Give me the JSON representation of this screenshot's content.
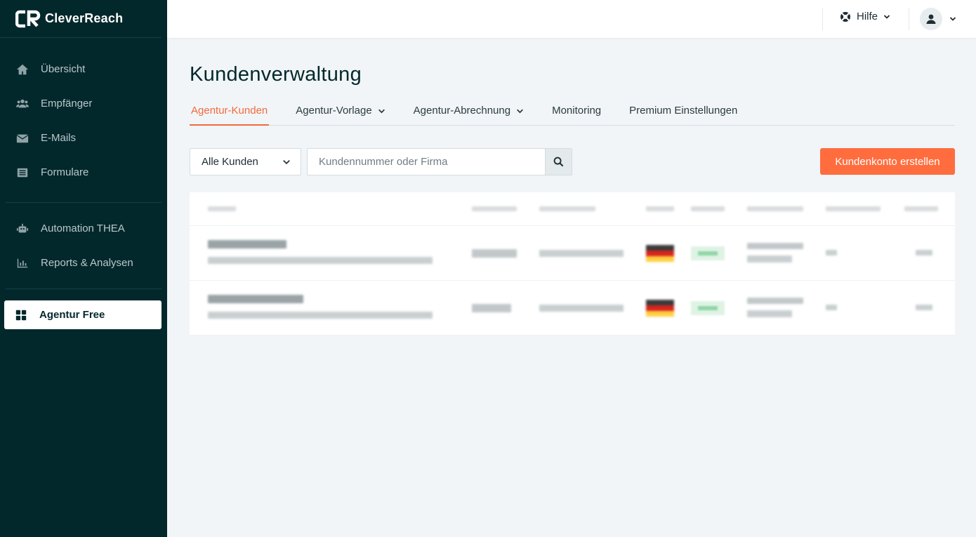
{
  "brand": {
    "name": "CleverReach"
  },
  "sidebar": {
    "items": [
      {
        "label": "Übersicht",
        "icon": "home-icon"
      },
      {
        "label": "Empfänger",
        "icon": "users-icon"
      },
      {
        "label": "E-Mails",
        "icon": "envelope-icon"
      },
      {
        "label": "Formulare",
        "icon": "list-icon"
      },
      {
        "label": "Automation THEA",
        "icon": "robot-icon"
      },
      {
        "label": "Reports & Analysen",
        "icon": "bar-chart-icon"
      },
      {
        "label": "Agentur Free",
        "icon": "grid-icon",
        "active": true
      }
    ]
  },
  "topbar": {
    "help_label": "Hilfe",
    "help_icon": "lifebuoy-icon",
    "user_icon": "user-icon"
  },
  "page": {
    "title": "Kundenverwaltung",
    "tabs": [
      {
        "label": "Agentur-Kunden",
        "active": true,
        "dropdown": false
      },
      {
        "label": "Agentur-Vorlage",
        "active": false,
        "dropdown": true
      },
      {
        "label": "Agentur-Abrechnung",
        "active": false,
        "dropdown": true
      },
      {
        "label": "Monitoring",
        "active": false,
        "dropdown": false
      },
      {
        "label": "Premium Einstellungen",
        "active": false,
        "dropdown": false
      }
    ]
  },
  "filters": {
    "customer_select_value": "Alle Kunden",
    "search_placeholder": "Kundennummer oder Firma",
    "create_button_label": "Kundenkonto erstellen"
  },
  "colors": {
    "sidebar_bg": "#03282c",
    "accent": "#ff6d3f",
    "tab_active": "#f26a3d",
    "page_bg": "#f1f5f7"
  }
}
